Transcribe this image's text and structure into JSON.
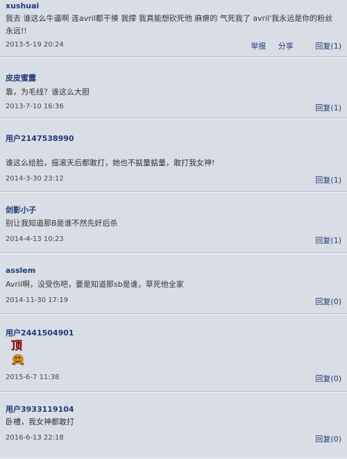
{
  "comments": [
    {
      "user": "xushuai",
      "text": "我去 谁这么牛逼啊 连avril都干揍 我撑 我真能想砍死他 麻痹的 气死我了 avril'我永远是你的粉丝 永远!!",
      "time": "2013-5-19  20:24",
      "report_label": "举报",
      "share_label": "分享",
      "reply_label": "回复",
      "reply_count": "(1)"
    },
    {
      "user": "皮皮蜜露",
      "text": "靠，为毛线？谁这么大胆",
      "time": "2013-7-10  16:36",
      "reply_label": "回复",
      "reply_count": "(1)"
    },
    {
      "user": "用户2147538990",
      "text": "谁这么给脸，摇滚天后都敢打，她也不掂量掂量，敢打我女神!",
      "time": "2014-3-30  23:12",
      "reply_label": "回复",
      "reply_count": "(1)"
    },
    {
      "user": "剑影小子",
      "text": "别让我知道那B是谁不然先奸后杀",
      "time": "2014-4-13  10:23",
      "reply_label": "回复",
      "reply_count": "(1)"
    },
    {
      "user": "asslem",
      "text": "Avril啊，没受伤吧，要是知道那sb是谁，草死他全家",
      "time": "2014-11-30  17:19",
      "reply_label": "回复",
      "reply_count": "(0)"
    },
    {
      "user": "用户2441504901",
      "sticker_text": "顶",
      "time": "2015-6-7  11:38",
      "reply_label": "回复",
      "reply_count": "(0)"
    },
    {
      "user": "用户3933119104",
      "text": "卧槽，我女神都敢打",
      "time": "2016-6-13  22:18",
      "reply_label": "回复",
      "reply_count": "(0)"
    }
  ],
  "colors": {
    "background": "#d9dde6",
    "username": "#1f3a78",
    "link": "#1f3a78",
    "sticker_red": "#d22b1f",
    "sticker_body": "#c9892a"
  }
}
